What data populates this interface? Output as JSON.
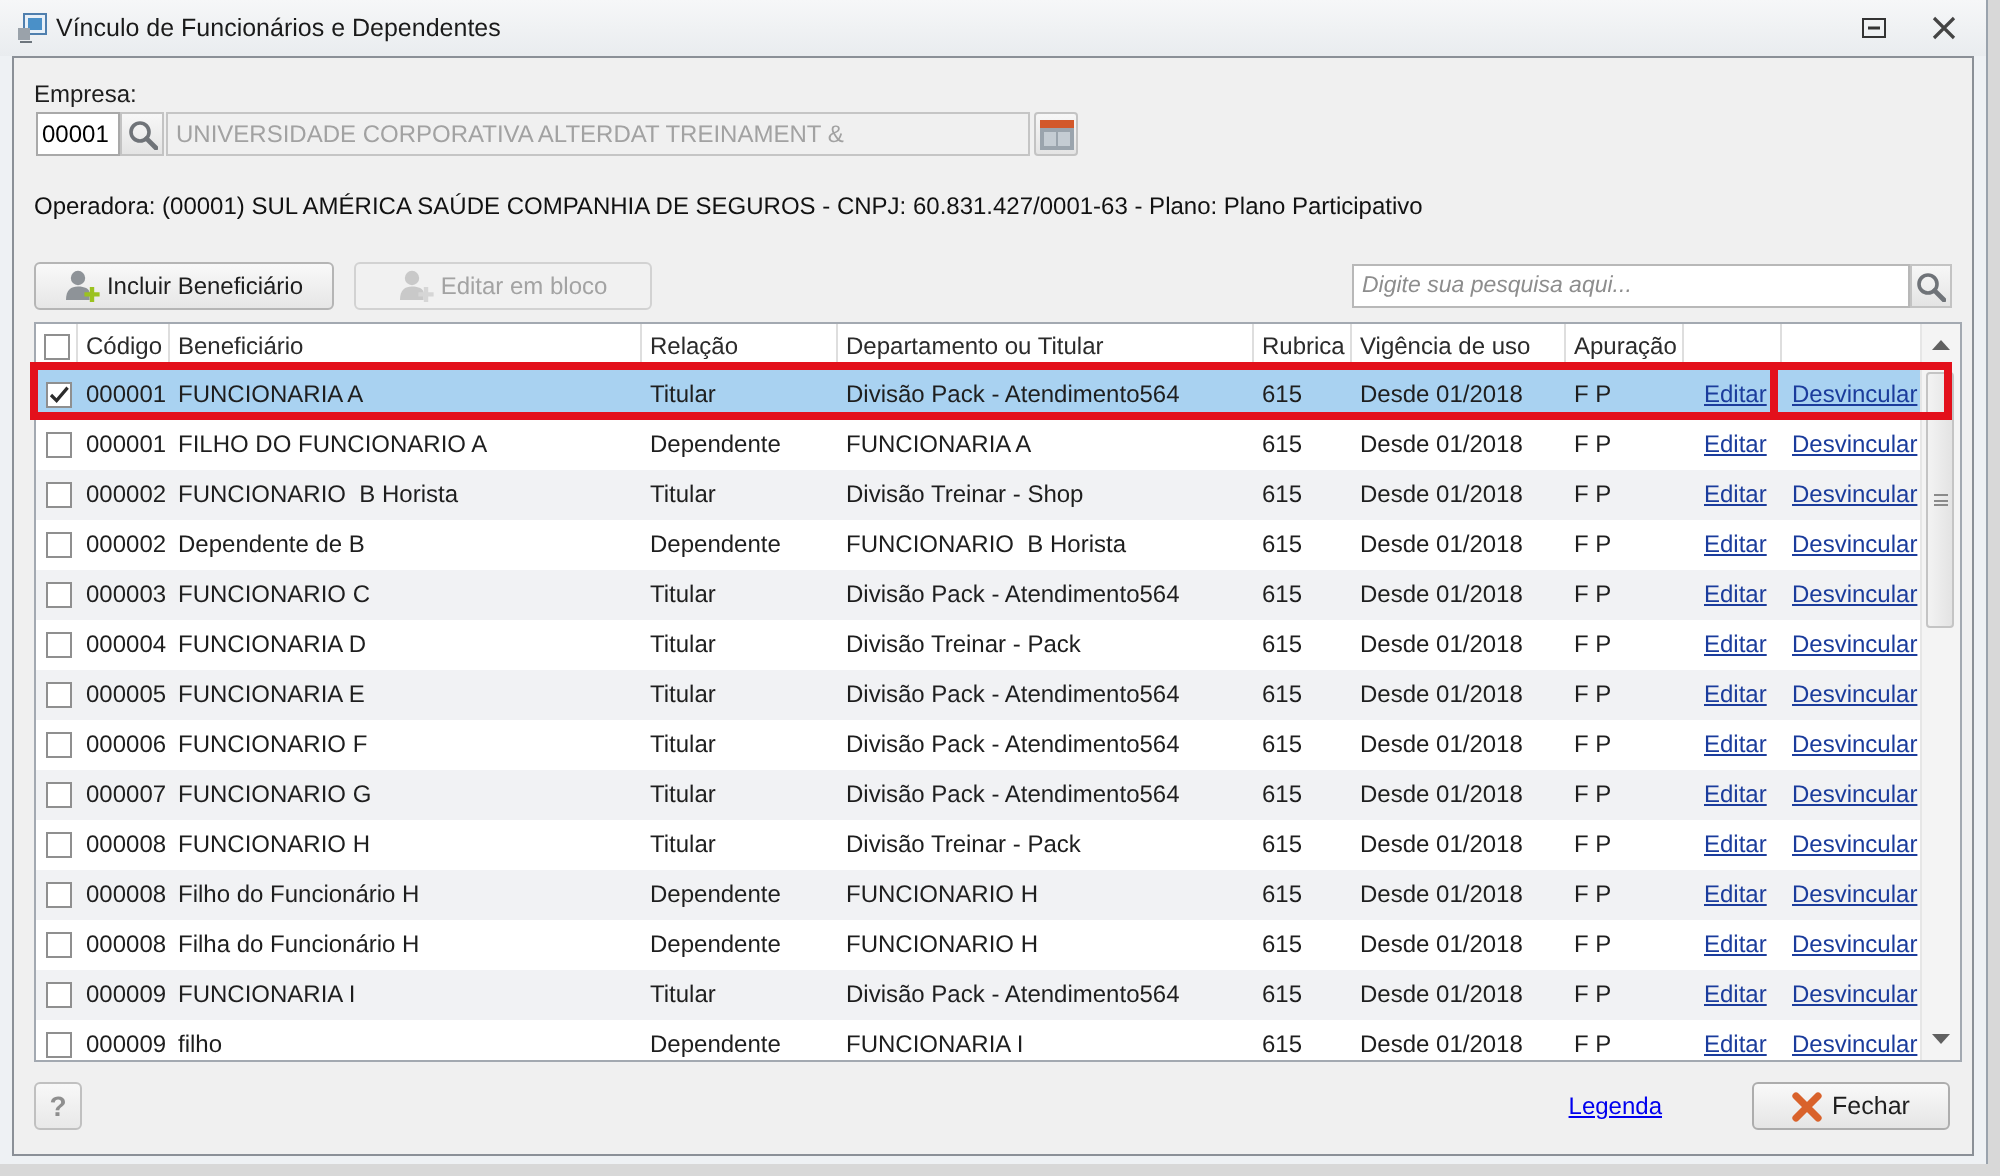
{
  "window": {
    "title": "Vínculo de Funcionários e Dependentes"
  },
  "empresa": {
    "label": "Empresa:",
    "code": "00001",
    "name_field": {
      "value": "UNIVERSIDADE CORPORATIVA ALTERDAT TREINAMENT &",
      "disabled": true
    }
  },
  "operadora_info": "Operadora: (00001) SUL AMÉRICA SAÚDE COMPANHIA DE SEGUROS - CNPJ: 60.831.427/0001-63 - Plano: Plano Participativo",
  "toolbar": {
    "buttons": [
      {
        "label": "Incluir Beneficiário",
        "disabled": false
      },
      {
        "label": "Editar em bloco",
        "disabled": true
      }
    ],
    "search": {
      "placeholder": "Digite sua pesquisa aqui..."
    }
  },
  "table": {
    "header_checked": false,
    "columns": [
      "Código",
      "Beneficiário",
      "Relação",
      "Departamento ou Titular",
      "Rubrica",
      "Vigência de uso",
      "Apuração"
    ],
    "rows": [
      {
        "checked": true,
        "selected": true,
        "highlighted": true,
        "codigo": "000001",
        "beneficiario": "FUNCIONARIA A",
        "relacao": "Titular",
        "departamento": "Divisão Pack - Atendimento564",
        "rubrica": "615",
        "vigencia": "Desde 01/2018",
        "apuracao": "F P",
        "edit_link": "Editar",
        "unlink_link": "Desvincular"
      },
      {
        "checked": false,
        "selected": false,
        "highlighted": false,
        "codigo": "000001",
        "beneficiario": "FILHO DO FUNCIONARIO A",
        "relacao": "Dependente",
        "departamento": "FUNCIONARIA A",
        "rubrica": "615",
        "vigencia": "Desde 01/2018",
        "apuracao": "F P",
        "edit_link": "Editar",
        "unlink_link": "Desvincular"
      },
      {
        "checked": false,
        "selected": false,
        "highlighted": false,
        "codigo": "000002",
        "beneficiario": "FUNCIONARIO  B Horista",
        "relacao": "Titular",
        "departamento": "Divisão Treinar - Shop",
        "rubrica": "615",
        "vigencia": "Desde 01/2018",
        "apuracao": "F P",
        "edit_link": "Editar",
        "unlink_link": "Desvincular"
      },
      {
        "checked": false,
        "selected": false,
        "highlighted": false,
        "codigo": "000002",
        "beneficiario": "Dependente de B",
        "relacao": "Dependente",
        "departamento": "FUNCIONARIO  B Horista",
        "rubrica": "615",
        "vigencia": "Desde 01/2018",
        "apuracao": "F P",
        "edit_link": "Editar",
        "unlink_link": "Desvincular"
      },
      {
        "checked": false,
        "selected": false,
        "highlighted": false,
        "codigo": "000003",
        "beneficiario": "FUNCIONARIO C",
        "relacao": "Titular",
        "departamento": "Divisão Pack - Atendimento564",
        "rubrica": "615",
        "vigencia": "Desde 01/2018",
        "apuracao": "F P",
        "edit_link": "Editar",
        "unlink_link": "Desvincular"
      },
      {
        "checked": false,
        "selected": false,
        "highlighted": false,
        "codigo": "000004",
        "beneficiario": "FUNCIONARIA D",
        "relacao": "Titular",
        "departamento": "Divisão Treinar - Pack",
        "rubrica": "615",
        "vigencia": "Desde 01/2018",
        "apuracao": "F P",
        "edit_link": "Editar",
        "unlink_link": "Desvincular"
      },
      {
        "checked": false,
        "selected": false,
        "highlighted": false,
        "codigo": "000005",
        "beneficiario": "FUNCIONARIA E",
        "relacao": "Titular",
        "departamento": "Divisão Pack - Atendimento564",
        "rubrica": "615",
        "vigencia": "Desde 01/2018",
        "apuracao": "F P",
        "edit_link": "Editar",
        "unlink_link": "Desvincular"
      },
      {
        "checked": false,
        "selected": false,
        "highlighted": false,
        "codigo": "000006",
        "beneficiario": "FUNCIONARIO F",
        "relacao": "Titular",
        "departamento": "Divisão Pack - Atendimento564",
        "rubrica": "615",
        "vigencia": "Desde 01/2018",
        "apuracao": "F P",
        "edit_link": "Editar",
        "unlink_link": "Desvincular"
      },
      {
        "checked": false,
        "selected": false,
        "highlighted": false,
        "codigo": "000007",
        "beneficiario": "FUNCIONARIO G",
        "relacao": "Titular",
        "departamento": "Divisão Pack - Atendimento564",
        "rubrica": "615",
        "vigencia": "Desde 01/2018",
        "apuracao": "F P",
        "edit_link": "Editar",
        "unlink_link": "Desvincular"
      },
      {
        "checked": false,
        "selected": false,
        "highlighted": false,
        "codigo": "000008",
        "beneficiario": "FUNCIONARIO H",
        "relacao": "Titular",
        "departamento": "Divisão Treinar - Pack",
        "rubrica": "615",
        "vigencia": "Desde 01/2018",
        "apuracao": "F P",
        "edit_link": "Editar",
        "unlink_link": "Desvincular"
      },
      {
        "checked": false,
        "selected": false,
        "highlighted": false,
        "codigo": "000008",
        "beneficiario": "Filho do Funcionário H",
        "relacao": "Dependente",
        "departamento": "FUNCIONARIO H",
        "rubrica": "615",
        "vigencia": "Desde 01/2018",
        "apuracao": "F P",
        "edit_link": "Editar",
        "unlink_link": "Desvincular"
      },
      {
        "checked": false,
        "selected": false,
        "highlighted": false,
        "codigo": "000008",
        "beneficiario": "Filha do Funcionário H",
        "relacao": "Dependente",
        "departamento": "FUNCIONARIO H",
        "rubrica": "615",
        "vigencia": "Desde 01/2018",
        "apuracao": "F P",
        "edit_link": "Editar",
        "unlink_link": "Desvincular"
      },
      {
        "checked": false,
        "selected": false,
        "highlighted": false,
        "codigo": "000009",
        "beneficiario": "FUNCIONARIA I",
        "relacao": "Titular",
        "departamento": "Divisão Pack - Atendimento564",
        "rubrica": "615",
        "vigencia": "Desde 01/2018",
        "apuracao": "F P",
        "edit_link": "Editar",
        "unlink_link": "Desvincular"
      },
      {
        "checked": false,
        "selected": false,
        "highlighted": false,
        "codigo": "000009",
        "beneficiario": "filho",
        "relacao": "Dependente",
        "departamento": "FUNCIONARIA I",
        "rubrica": "615",
        "vigencia": "Desde 01/2018",
        "apuracao": "F P",
        "edit_link": "Editar",
        "unlink_link": "Desvincular"
      }
    ]
  },
  "footer": {
    "help_button": "?",
    "legend_link": "Legenda",
    "close_button": "Fechar"
  }
}
